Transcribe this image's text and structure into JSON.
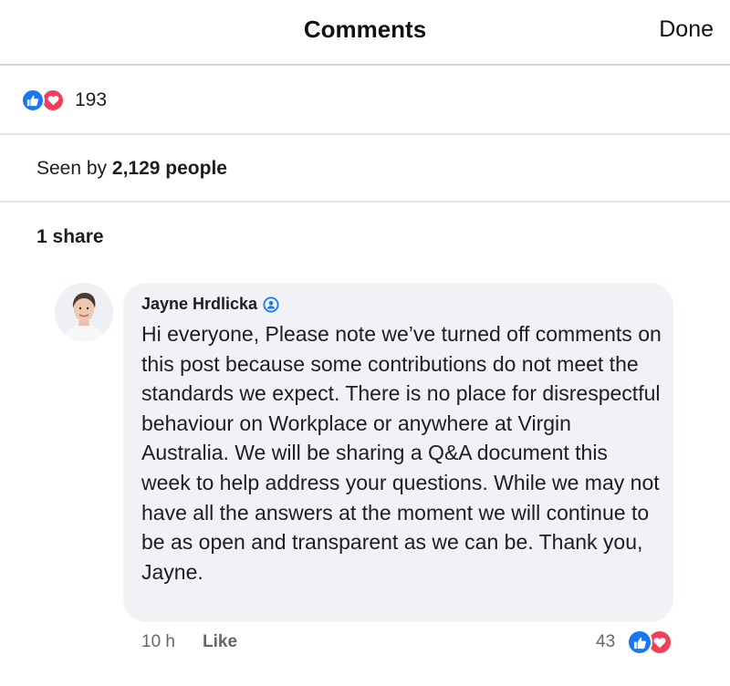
{
  "header": {
    "title": "Comments",
    "done_label": "Done"
  },
  "post_stats": {
    "reaction_count": "193",
    "reaction_icons": [
      "like-icon",
      "love-icon"
    ],
    "seen_prefix": "Seen by",
    "seen_count": "2,129 people",
    "shares": "1 share"
  },
  "comment": {
    "author": "Jayne Hrdlicka",
    "author_badge_icon": "admin-badge-icon",
    "text": "Hi everyone, Please note we’ve turned off comments on this post because some contributions do not meet the standards we expect. There is no place for disrespectful behaviour on Workplace or anywhere at Virgin Australia.  We will be sharing a Q&A document this week to help address your questions. While we may not have all the answers at the moment we will continue to be as open and transparent as we can be. Thank you, Jayne.",
    "time": "10 h",
    "like_label": "Like",
    "reaction_count": "43",
    "reaction_icons": [
      "like-icon",
      "love-icon"
    ]
  },
  "colors": {
    "like_blue": "#1877f2",
    "love_red": "#f33e58",
    "bubble_bg": "#f0f2f5",
    "meta_gray": "#65676b"
  }
}
